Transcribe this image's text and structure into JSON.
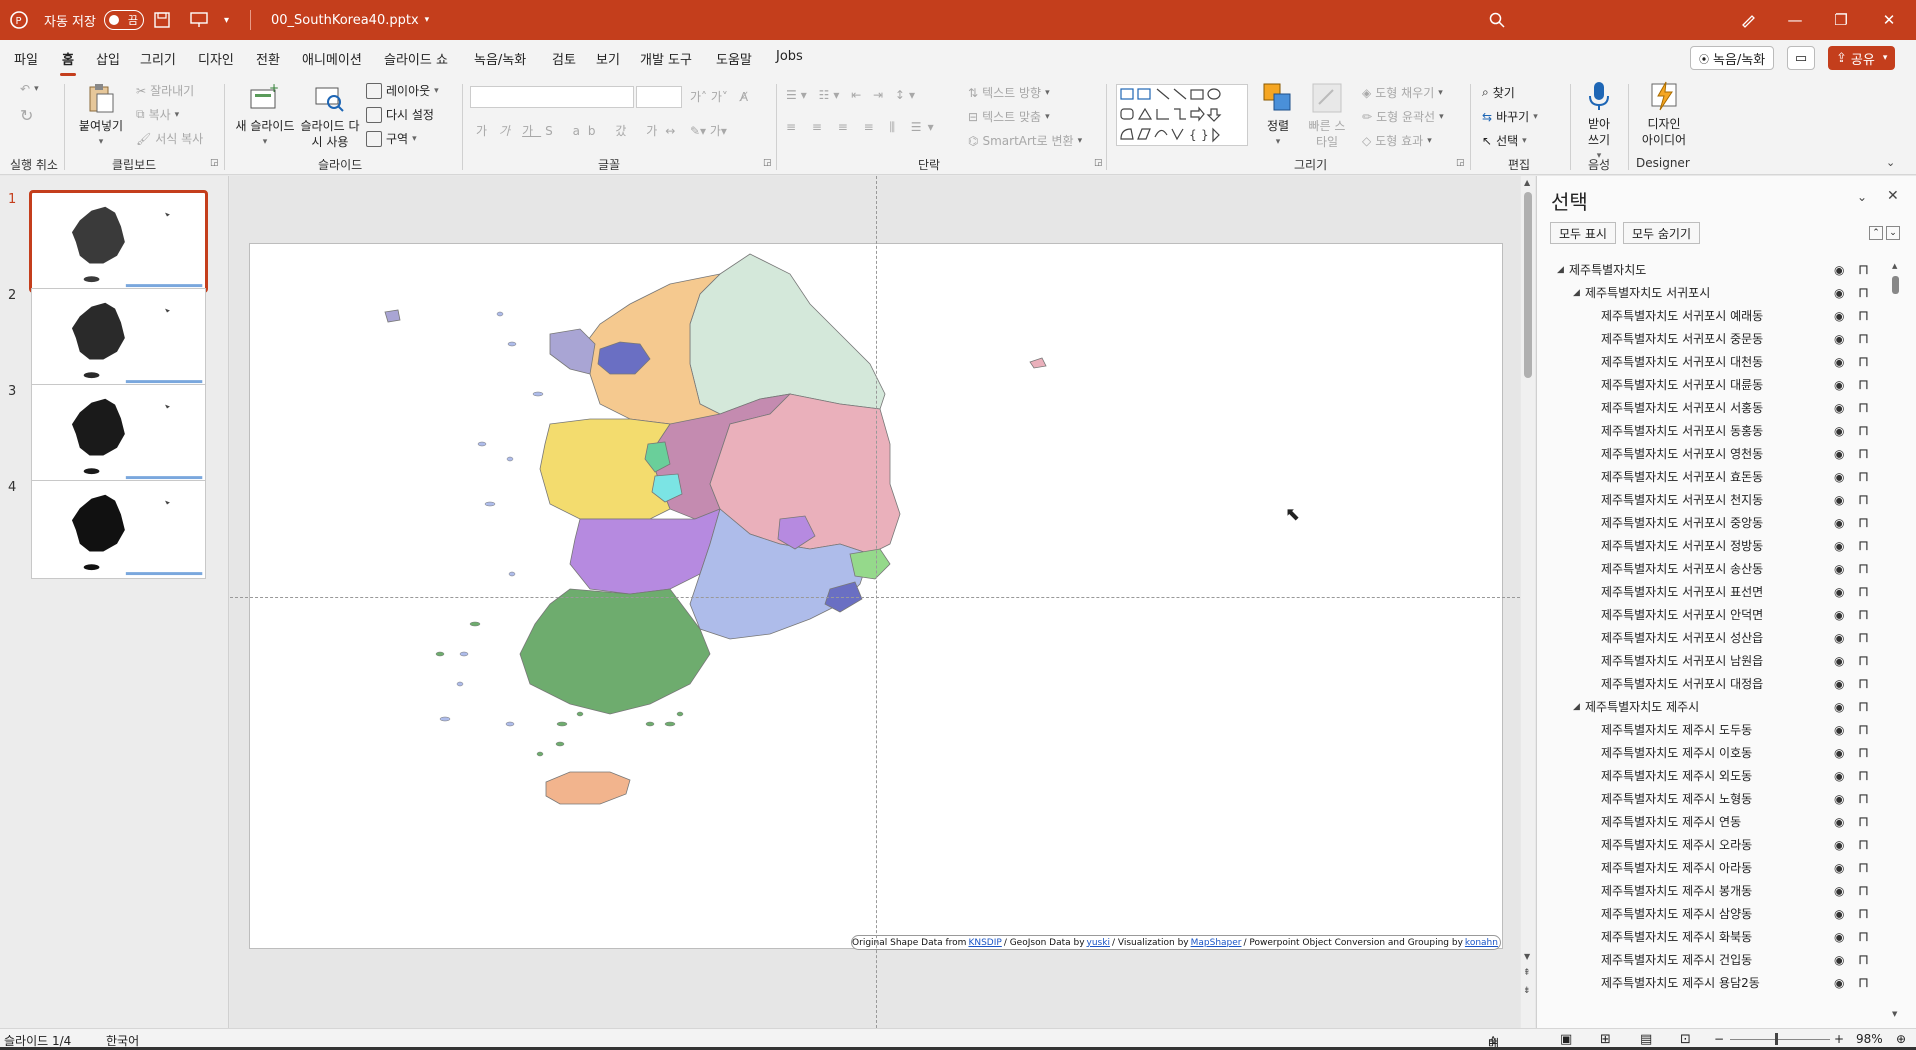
{
  "titlebar": {
    "autosave_label": "자동 저장",
    "autosave_state": "끔",
    "filename": "00_SouthKorea40.pptx",
    "accent": "#c43e1c"
  },
  "tabs": [
    "파일",
    "홈",
    "삽입",
    "그리기",
    "디자인",
    "전환",
    "애니메이션",
    "슬라이드 쇼",
    "녹음/녹화",
    "검토",
    "보기",
    "개발 도구",
    "도움말",
    "Jobs"
  ],
  "tab_right": {
    "record": "녹음/녹화",
    "share": "공유"
  },
  "ribbon": {
    "undo_group": "실행 취소",
    "clipboard": {
      "paste": "붙여넣기",
      "cut": "잘라내기",
      "copy": "복사",
      "format": "서식 복사",
      "label": "클립보드"
    },
    "slides": {
      "new": "새 슬라이드",
      "reuse": "슬라이드 다시 사용",
      "layout": "레이아웃",
      "reset": "다시 설정",
      "section": "구역",
      "label": "슬라이드"
    },
    "font_label": "글꼴",
    "paragraph": {
      "direction": "텍스트 방향",
      "align": "텍스트 맞춤",
      "smartart": "SmartArt로 변환",
      "label": "단락"
    },
    "drawing": {
      "arrange": "정렬",
      "quick_styles": "빠른 스타일",
      "fill": "도형 채우기",
      "outline": "도형 윤곽선",
      "effects": "도형 효과",
      "label": "그리기"
    },
    "editing": {
      "find": "찾기",
      "replace": "바꾸기",
      "select": "선택",
      "label": "편집"
    },
    "voice": {
      "dictate": "받아쓰기",
      "label": "음성"
    },
    "designer": {
      "ideas": "디자인 아이디어",
      "label": "Designer"
    }
  },
  "slides": [
    {
      "number": "1",
      "active": true
    },
    {
      "number": "2",
      "active": false
    },
    {
      "number": "3",
      "active": false
    },
    {
      "number": "4",
      "active": false
    }
  ],
  "credits": {
    "text1": "Original Shape Data from",
    "link1": "KNSDIP",
    "text2": "/ GeoJson Data by",
    "link2": "yuski",
    "text3": "/ Visualization  by",
    "link3": "MapShaper",
    "text4": "/ Powerpoint Object Conversion and Grouping  by",
    "link4": "konahn"
  },
  "selection_pane": {
    "title": "선택",
    "show_all": "모두 표시",
    "hide_all": "모두 숨기기",
    "items": [
      {
        "label": "제주특별자치도",
        "level": 0,
        "expanded": true
      },
      {
        "label": "제주특별자치도 서귀포시",
        "level": 1,
        "expanded": true
      },
      {
        "label": "제주특별자치도 서귀포시 예래동",
        "level": 2
      },
      {
        "label": "제주특별자치도 서귀포시 중문동",
        "level": 2
      },
      {
        "label": "제주특별자치도 서귀포시 대천동",
        "level": 2
      },
      {
        "label": "제주특별자치도 서귀포시 대륜동",
        "level": 2
      },
      {
        "label": "제주특별자치도 서귀포시 서홍동",
        "level": 2
      },
      {
        "label": "제주특별자치도 서귀포시 동홍동",
        "level": 2
      },
      {
        "label": "제주특별자치도 서귀포시 영천동",
        "level": 2
      },
      {
        "label": "제주특별자치도 서귀포시 효돈동",
        "level": 2
      },
      {
        "label": "제주특별자치도 서귀포시 천지동",
        "level": 2
      },
      {
        "label": "제주특별자치도 서귀포시 중앙동",
        "level": 2
      },
      {
        "label": "제주특별자치도 서귀포시 정방동",
        "level": 2
      },
      {
        "label": "제주특별자치도 서귀포시 송산동",
        "level": 2
      },
      {
        "label": "제주특별자치도 서귀포시 표선면",
        "level": 2
      },
      {
        "label": "제주특별자치도 서귀포시 안덕면",
        "level": 2
      },
      {
        "label": "제주특별자치도 서귀포시 성산읍",
        "level": 2
      },
      {
        "label": "제주특별자치도 서귀포시 남원읍",
        "level": 2
      },
      {
        "label": "제주특별자치도 서귀포시 대정읍",
        "level": 2
      },
      {
        "label": "제주특별자치도 제주시",
        "level": 1,
        "expanded": true
      },
      {
        "label": "제주특별자치도 제주시 도두동",
        "level": 2
      },
      {
        "label": "제주특별자치도 제주시 이호동",
        "level": 2
      },
      {
        "label": "제주특별자치도 제주시 외도동",
        "level": 2
      },
      {
        "label": "제주특별자치도 제주시 노형동",
        "level": 2
      },
      {
        "label": "제주특별자치도 제주시 연동",
        "level": 2
      },
      {
        "label": "제주특별자치도 제주시 오라동",
        "level": 2
      },
      {
        "label": "제주특별자치도 제주시 아라동",
        "level": 2
      },
      {
        "label": "제주특별자치도 제주시 봉개동",
        "level": 2
      },
      {
        "label": "제주특별자치도 제주시 삼양동",
        "level": 2
      },
      {
        "label": "제주특별자치도 제주시 화북동",
        "level": 2
      },
      {
        "label": "제주특별자치도 제주시 건입동",
        "level": 2
      },
      {
        "label": "제주특별자치도 제주시 용담2동",
        "level": 2
      }
    ]
  },
  "status": {
    "slide": "슬라이드 1/4",
    "language": "한국어",
    "notes": "메모",
    "zoom": "98%"
  },
  "map_colors": {
    "gyeonggi": "#f5c98f",
    "gangwon": "#d4e8da",
    "chungbuk": "#c48bb0",
    "chungnam": "#f3dc6e",
    "gyeongbuk": "#eab0bb",
    "jeonbuk": "#b68ae0",
    "jeonnam": "#6eac6e",
    "gyeongnam": "#aebcea",
    "jeju": "#f2b48d",
    "seoul": "#6a6fc3",
    "incheon": "#a9a5d4",
    "ulsan": "#95d98b",
    "sejong": "#6acf9a",
    "daejeon": "#7be4e4"
  }
}
